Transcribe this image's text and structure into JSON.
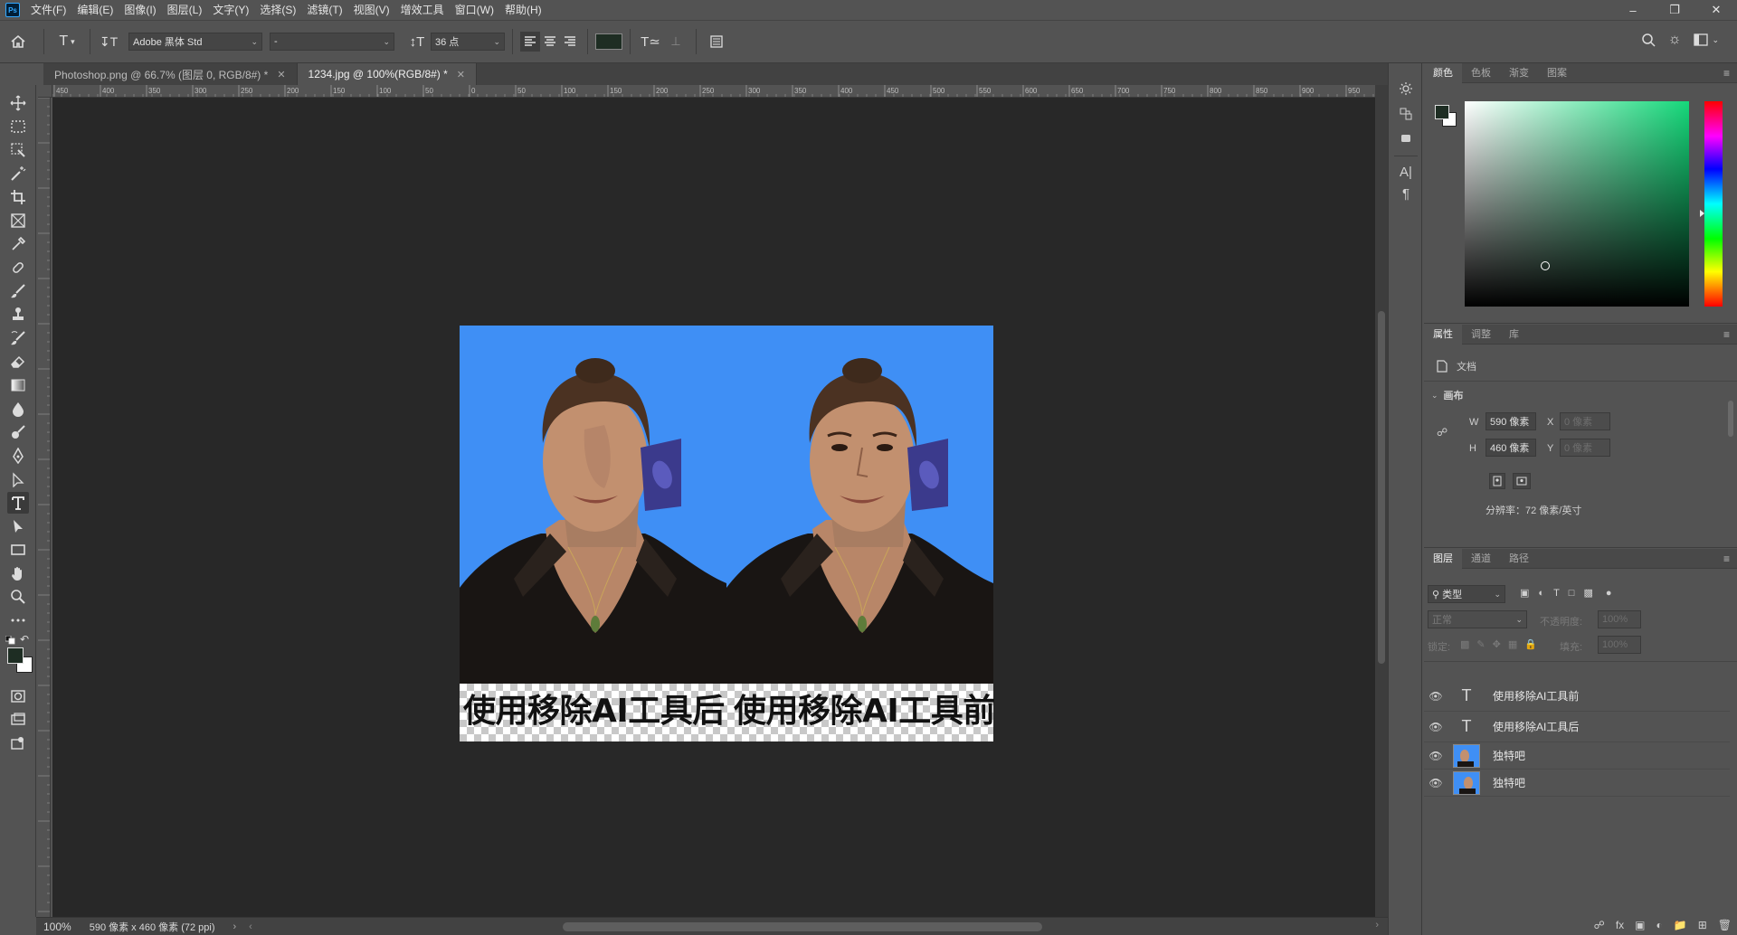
{
  "app": {
    "menu": [
      "文件(F)",
      "编辑(E)",
      "图像(I)",
      "图层(L)",
      "文字(Y)",
      "选择(S)",
      "滤镜(T)",
      "视图(V)",
      "增效工具",
      "窗口(W)",
      "帮助(H)"
    ]
  },
  "options": {
    "font_family": "Adobe 黑体 Std",
    "font_style": "-",
    "font_size": "36 点"
  },
  "tabs": [
    {
      "label": "Photoshop.png @ 66.7% (图层 0, RGB/8#) *"
    },
    {
      "label": "1234.jpg @ 100%(RGB/8#) *"
    }
  ],
  "ruler": {
    "h_ticks": [
      "450",
      "400",
      "350",
      "300",
      "250",
      "200",
      "150",
      "100",
      "50",
      "0",
      "50",
      "100",
      "150",
      "200",
      "250",
      "300",
      "350",
      "400",
      "450",
      "500",
      "550",
      "600",
      "650",
      "700",
      "750",
      "800",
      "850",
      "900",
      "950"
    ]
  },
  "canvas": {
    "caption_left": "使用移除AI工具后",
    "caption_right": "使用移除AI工具前"
  },
  "color_panel": {
    "tabs": [
      "颜色",
      "色板",
      "渐变",
      "图案"
    ],
    "foreground": "#1e2d23",
    "background": "#ffffff"
  },
  "properties_panel": {
    "tabs": [
      "属性",
      "调整",
      "库"
    ],
    "doc_label": "文档",
    "section": "画布",
    "w_label": "W",
    "w_value": "590 像素",
    "h_label": "H",
    "h_value": "460 像素",
    "x_label": "X",
    "x_value": "0 像素",
    "y_label": "Y",
    "y_value": "0 像素",
    "resolution": "分辨率：72 像素/英寸"
  },
  "layers_panel": {
    "tabs": [
      "图层",
      "通道",
      "路径"
    ],
    "filter": "类型",
    "blend_mode": "正常",
    "opacity_label": "不透明度:",
    "opacity_value": "100%",
    "lock_label": "锁定:",
    "fill_label": "填充:",
    "fill_value": "100%",
    "layers": [
      {
        "name": "使用移除AI工具前",
        "kind": "text"
      },
      {
        "name": "使用移除AI工具后",
        "kind": "text"
      },
      {
        "name": "独特吧",
        "kind": "image"
      },
      {
        "name": "独特吧",
        "kind": "image"
      }
    ]
  },
  "status": {
    "zoom": "100%",
    "doc_size": "590 像素 x 460 像素 (72 ppi)"
  }
}
